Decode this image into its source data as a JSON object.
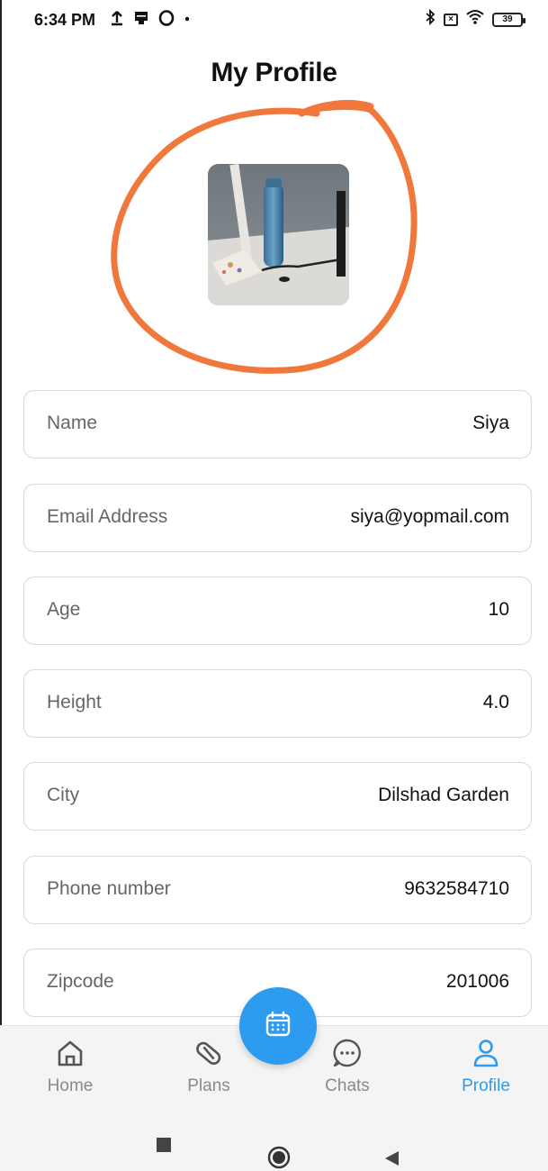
{
  "status_bar": {
    "time": "6:34 PM",
    "left_icons": [
      "upload-icon",
      "message-icon",
      "opera-icon",
      "dot-icon"
    ],
    "right_icons": [
      "bluetooth-icon",
      "sim-x-icon",
      "wifi-icon",
      "battery-icon"
    ],
    "battery": "39"
  },
  "page": {
    "title": "My Profile"
  },
  "annotation": {
    "color": "#f0783c"
  },
  "fields": [
    {
      "label": "Name",
      "value": "Siya"
    },
    {
      "label": "Email Address",
      "value": "siya@yopmail.com"
    },
    {
      "label": "Age",
      "value": "10"
    },
    {
      "label": "Height",
      "value": "4.0"
    },
    {
      "label": "City",
      "value": "Dilshad Garden"
    },
    {
      "label": "Phone number",
      "value": "9632584710"
    },
    {
      "label": "Zipcode",
      "value": "201006"
    }
  ],
  "bottom_nav": {
    "active_color": "#2d9bf0",
    "items": [
      {
        "label": "Home",
        "icon": "home-icon"
      },
      {
        "label": "Plans",
        "icon": "pill-icon"
      },
      {
        "label": "Chats",
        "icon": "chat-icon"
      },
      {
        "label": "Profile",
        "icon": "person-icon"
      }
    ],
    "fab_icon": "calendar-icon"
  },
  "system_nav": [
    "recents-icon",
    "home-circle-icon",
    "back-icon"
  ]
}
